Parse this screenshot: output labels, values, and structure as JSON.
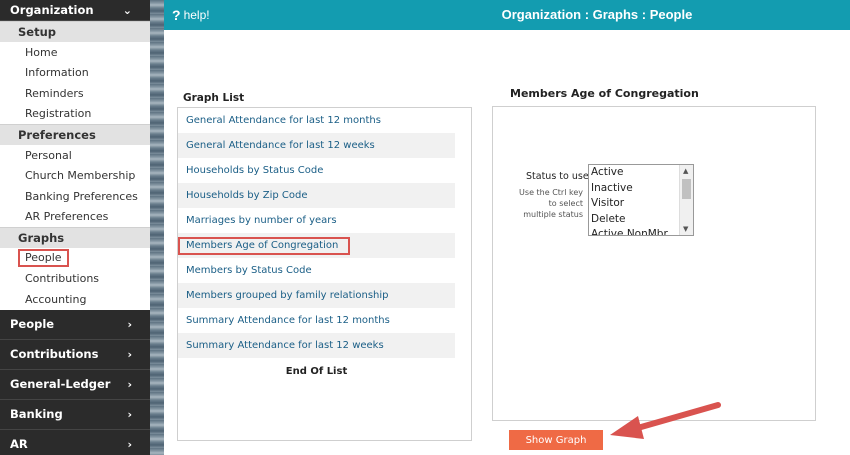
{
  "sidebar": {
    "top": {
      "label": "Organization",
      "chevron": "chevron-down-icon"
    },
    "sections": [
      {
        "title": "Setup",
        "items": [
          "Home",
          "Information",
          "Reminders",
          "Registration"
        ]
      },
      {
        "title": "Preferences",
        "items": [
          "Personal",
          "Church Membership",
          "Banking Preferences",
          "AR Preferences"
        ]
      },
      {
        "title": "Graphs",
        "items": [
          "People",
          "Contributions",
          "Accounting"
        ]
      }
    ],
    "active_item": "People",
    "bottom": [
      {
        "label": "People",
        "chevron": "chevron-right-icon"
      },
      {
        "label": "Contributions",
        "chevron": "chevron-right-icon"
      },
      {
        "label": "General-Ledger",
        "chevron": "chevron-right-icon"
      },
      {
        "label": "Banking",
        "chevron": "chevron-right-icon"
      },
      {
        "label": "AR",
        "chevron": "chevron-right-icon"
      }
    ]
  },
  "header": {
    "help_icon": "?",
    "help_label": "help!",
    "title": "Organization : Graphs : People",
    "color": "#139cb0"
  },
  "graph_list": {
    "title": "Graph List",
    "items": [
      "General Attendance for last 12 months",
      "General Attendance for last 12 weeks",
      "Households by Status Code",
      "Households by Zip Code",
      "Marriages by number of years",
      "Members Age of Congregation",
      "Members by Status Code",
      "Members grouped by family relationship",
      "Summary Attendance for last 12 months",
      "Summary Attendance for last 12 weeks"
    ],
    "selected": "Members Age of Congregation",
    "end_label": "End Of List"
  },
  "graph_panel": {
    "title": "Members Age of Congregation",
    "status_label": "Status to use",
    "status_help": [
      "Use the Ctrl key",
      "to select",
      "multiple status"
    ],
    "status_options": [
      "Active",
      "Inactive",
      "Visitor",
      "Delete",
      "Active NonMbr"
    ],
    "show_graph_label": "Show Graph",
    "button_color": "#ef6a45"
  }
}
